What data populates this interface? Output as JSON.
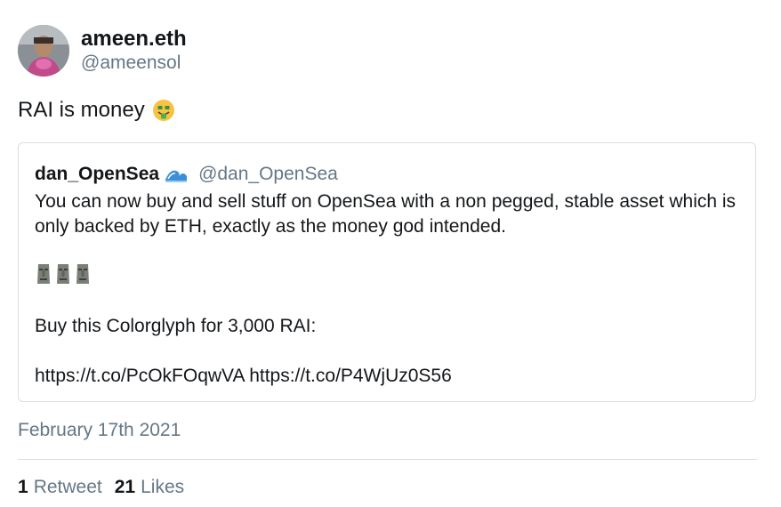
{
  "author": {
    "display_name": "ameen.eth",
    "handle": "@ameensol",
    "avatar": "user-avatar"
  },
  "tweet": {
    "text": "RAI is money",
    "emoji": "money-mouth-face-emoji"
  },
  "quoted_tweet": {
    "display_name": "dan_OpenSea",
    "name_emoji": "water-wave-emoji",
    "handle": "@dan_OpenSea",
    "body": "You can now buy and sell stuff on OpenSea with a non pegged, stable asset which is only backed by ETH, exactly as the money god intended.",
    "emoji_row": [
      "moai-emoji",
      "moai-emoji",
      "moai-emoji"
    ],
    "line2": "Buy this Colorglyph for 3,000 RAI:",
    "links": "https://t.co/PcOkFOqwVA https://t.co/P4WjUz0S56"
  },
  "timestamp": "February 17th 2021",
  "stats": {
    "retweets_count": "1",
    "retweets_label": "Retweet",
    "likes_count": "21",
    "likes_label": "Likes"
  },
  "colors": {
    "text_primary": "#14171a",
    "text_secondary": "#657786",
    "border": "#d8dee2"
  }
}
